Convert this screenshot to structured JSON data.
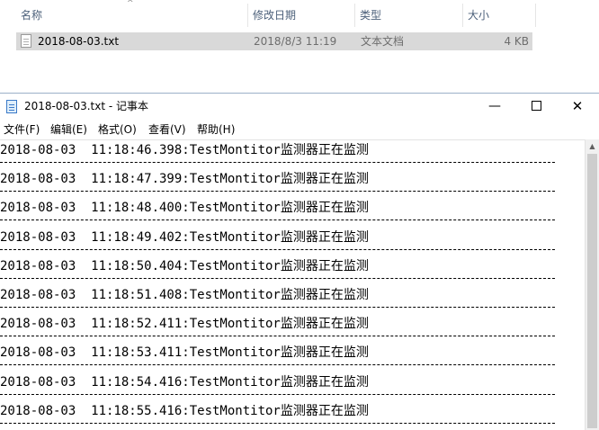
{
  "explorer": {
    "columns": {
      "name": "名称",
      "date": "修改日期",
      "type": "类型",
      "size": "大小"
    },
    "sort_arrow": "^",
    "file": {
      "icon": "text-file-icon",
      "name": "2018-08-03.txt",
      "date": "2018/8/3 11:19",
      "type": "文本文档",
      "size": "4 KB"
    }
  },
  "notepad": {
    "icon": "notepad-icon",
    "title": "2018-08-03.txt - 记事本",
    "controls": {
      "minimize": "—",
      "maximize": "",
      "close": "✕"
    },
    "menu": {
      "file": "文件(F)",
      "edit": "编辑(E)",
      "format": "格式(O)",
      "view": "查看(V)",
      "help": "帮助(H)"
    },
    "lines": [
      "2018-08-03  11:18:46.398:TestMontitor监测器正在监测",
      "2018-08-03  11:18:47.399:TestMontitor监测器正在监测",
      "2018-08-03  11:18:48.400:TestMontitor监测器正在监测",
      "2018-08-03  11:18:49.402:TestMontitor监测器正在监测",
      "2018-08-03  11:18:50.404:TestMontitor监测器正在监测",
      "2018-08-03  11:18:51.408:TestMontitor监测器正在监测",
      "2018-08-03  11:18:52.411:TestMontitor监测器正在监测",
      "2018-08-03  11:18:53.411:TestMontitor监测器正在监测",
      "2018-08-03  11:18:54.416:TestMontitor监测器正在监测",
      "2018-08-03  11:18:55.416:TestMontitor监测器正在监测"
    ],
    "scroll_up": "▲"
  },
  "colors": {
    "selection": "#d9d9d9",
    "header_text": "#4c607a",
    "window_border": "#9bb0c8"
  }
}
